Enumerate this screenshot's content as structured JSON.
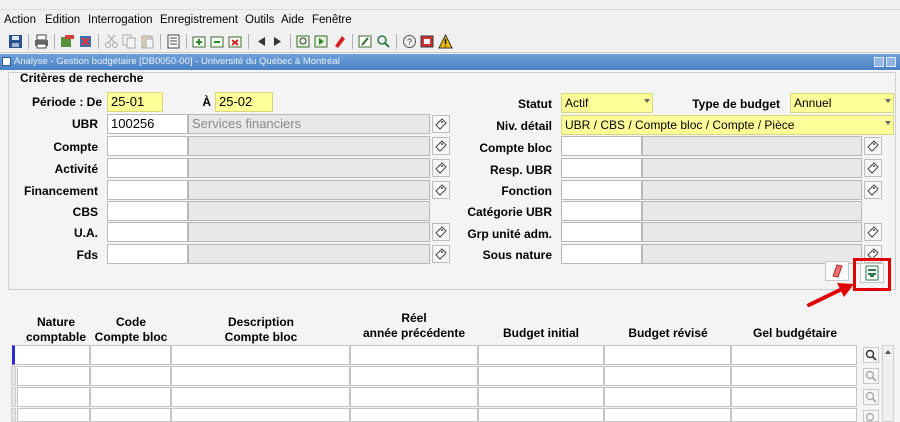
{
  "menu": [
    {
      "id": "action",
      "label": "Action"
    },
    {
      "id": "edition",
      "label": "Edition"
    },
    {
      "id": "interrogation",
      "label": "Interrogation"
    },
    {
      "id": "enregistrement",
      "label": "Enregistrement"
    },
    {
      "id": "outils",
      "label": "Outils"
    },
    {
      "id": "aide",
      "label": "Aide"
    },
    {
      "id": "fenetre",
      "label": "Fenêtre"
    }
  ],
  "toolbar_icons": [
    "save-icon",
    "print-icon",
    "open-icon",
    "close-form-icon",
    "cut-icon",
    "copy-icon",
    "paste-icon",
    "clear-icon",
    "insert-record-icon",
    "clear-record-icon",
    "delete-record-icon",
    "previous-icon",
    "next-icon",
    "enter-query-icon",
    "execute-query-icon",
    "cancel-query-icon",
    "edit-icon",
    "list-of-values-icon",
    "help-icon",
    "attachment-icon",
    "warning-icon"
  ],
  "window": {
    "title": "Analyse - Gestion budgétaire [DB0050-00] - Université du Québec à Montréal"
  },
  "criteria": {
    "title": "Critères de recherche",
    "periode_label": "Période : De",
    "periode_de": "25-01",
    "a_label": "À",
    "periode_a": "25-02",
    "ubr_label": "UBR",
    "ubr_value": "100256",
    "ubr_desc": "Services financiers",
    "compte_label": "Compte",
    "activite_label": "Activité",
    "financement_label": "Financement",
    "cbs_label": "CBS",
    "ua_label": "U.A.",
    "fds_label": "Fds",
    "statut_label": "Statut",
    "statut_value": "Actif",
    "type_budget_label": "Type de budget",
    "type_budget_value": "Annuel",
    "niv_detail_label": "Niv. détail",
    "niv_detail_value": "UBR / CBS / Compte bloc / Compte / Pièce",
    "compte_bloc_label": "Compte bloc",
    "resp_ubr_label": "Resp. UBR",
    "fonction_label": "Fonction",
    "categorie_ubr_label": "Catégorie UBR",
    "grp_unite_label": "Grp unité adm.",
    "sous_nature_label": "Sous nature"
  },
  "results": {
    "columns": [
      {
        "line1": "Nature",
        "line2": "comptable"
      },
      {
        "line1": "Code",
        "line2": "Compte bloc"
      },
      {
        "line1": "Description",
        "line2": "Compte bloc"
      },
      {
        "line1": "Réel",
        "line2": "année précédente"
      },
      {
        "line1": "",
        "line2": "Budget initial"
      },
      {
        "line1": "",
        "line2": "Budget révisé"
      },
      {
        "line1": "",
        "line2": "Gel budgétaire"
      }
    ],
    "row_count": 4
  },
  "colors": {
    "required_field": "#ffff99",
    "title_bar": "#4b82c6",
    "highlight": "#e00000"
  }
}
